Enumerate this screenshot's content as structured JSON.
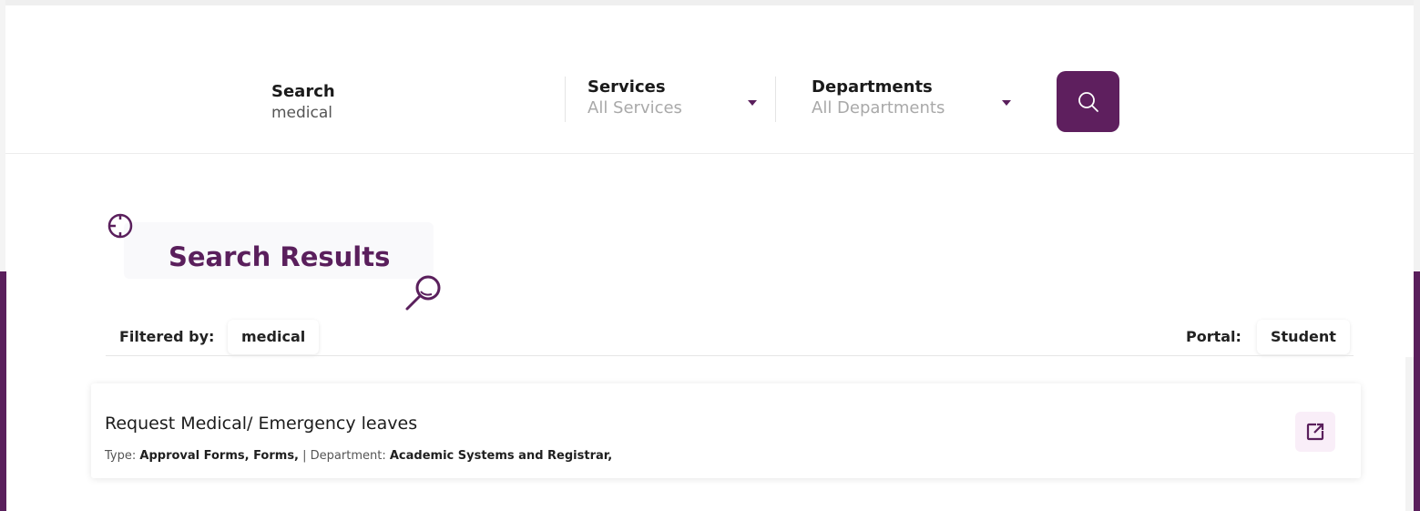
{
  "search_bar": {
    "search": {
      "label": "Search",
      "value": "medical"
    },
    "services": {
      "label": "Services",
      "value": "All Services"
    },
    "departments": {
      "label": "Departments",
      "value": "All Departments"
    }
  },
  "results": {
    "title": "Search Results",
    "filter_label": "Filtered by:",
    "filter_value": "medical",
    "portal_label": "Portal:",
    "portal_value": "Student",
    "items": [
      {
        "title": "Request Medical/ Emergency leaves",
        "type_label": "Type:",
        "type_value": "Approval Forms, Forms,",
        "separator": "|",
        "department_label": "Department:",
        "department_value": "Academic Systems and Registrar,"
      }
    ]
  },
  "colors": {
    "brand": "#5e1f5e",
    "chip_bg": "#ffffff",
    "link_bg": "#f9eef8"
  },
  "icons": {
    "search_button": "search-icon",
    "heading_decor_left": "target-icon",
    "heading_decor_right": "magnifier-icon",
    "result_action": "external-link-icon",
    "dropdown": "caret-down-icon"
  }
}
